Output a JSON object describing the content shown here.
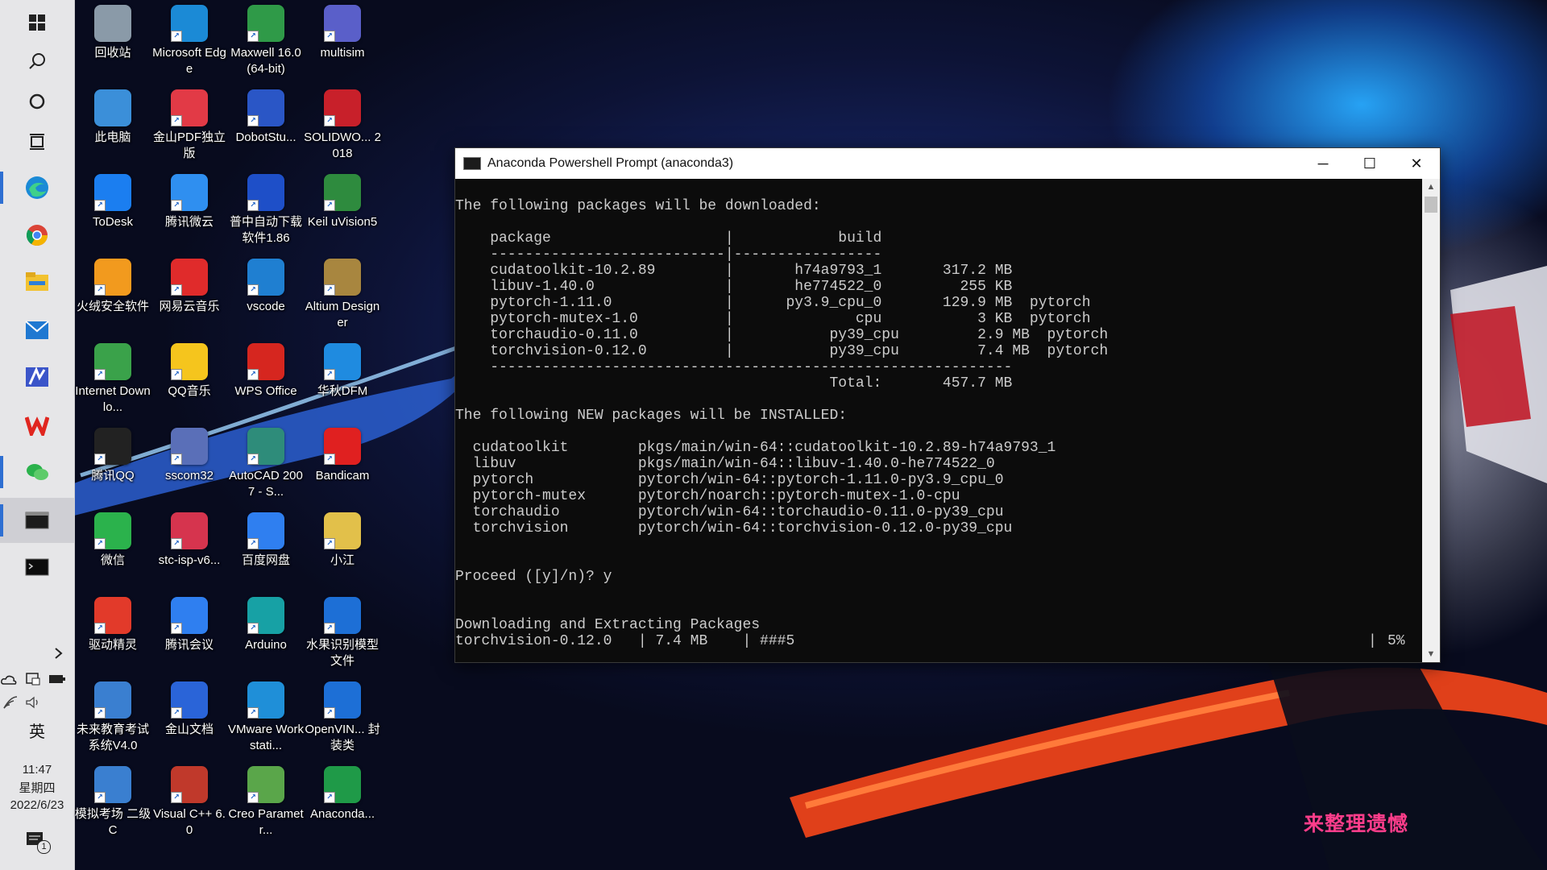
{
  "taskbar": {
    "start_icon": "windows-logo-icon",
    "pinned": [
      {
        "name": "search",
        "icon": "search-icon"
      },
      {
        "name": "cortana",
        "icon": "circle-icon"
      },
      {
        "name": "task-view",
        "icon": "task-view-icon"
      },
      {
        "name": "edge",
        "icon": "edge-icon"
      },
      {
        "name": "chrome",
        "icon": "chrome-icon"
      },
      {
        "name": "file-explorer",
        "icon": "folder-icon"
      },
      {
        "name": "mail",
        "icon": "mail-icon"
      },
      {
        "name": "multisim",
        "icon": "multisim-icon"
      },
      {
        "name": "wps",
        "icon": "wps-icon"
      },
      {
        "name": "wechat",
        "icon": "wechat-icon"
      },
      {
        "name": "anaconda-prompt",
        "icon": "terminal-icon"
      },
      {
        "name": "terminal",
        "icon": "terminal-icon"
      }
    ],
    "ime_label": "英",
    "time": "11:47",
    "weekday": "星期四",
    "date": "2022/6/23",
    "notification_count": "1"
  },
  "desktop": {
    "icons": [
      {
        "label": "回收站",
        "icon": "recycle-bin-icon",
        "color": "#8a9aa8"
      },
      {
        "label": "Microsoft Edge",
        "icon": "edge-icon",
        "color": "#1b8ad6"
      },
      {
        "label": "Maxwell 16.0 (64-bit)",
        "icon": "maxwell-icon",
        "color": "#2f9a48"
      },
      {
        "label": "multisim",
        "icon": "multisim-icon",
        "color": "#5a5fc9"
      },
      {
        "label": "此电脑",
        "icon": "computer-icon",
        "color": "#3b8fd9"
      },
      {
        "label": "金山PDF独立版",
        "icon": "pdf-icon",
        "color": "#e23a46"
      },
      {
        "label": "DobotStu...",
        "icon": "dobot-icon",
        "color": "#2a56c6"
      },
      {
        "label": "SOLIDWO... 2018",
        "icon": "solidworks-icon",
        "color": "#c8202a"
      },
      {
        "label": "ToDesk",
        "icon": "todesk-icon",
        "color": "#1b7ef0"
      },
      {
        "label": "腾讯微云",
        "icon": "weiyun-icon",
        "color": "#2f8ff0"
      },
      {
        "label": "普中自动下载软件1.86",
        "icon": "isp-icon",
        "color": "#1e4fc8"
      },
      {
        "label": "Keil uVision5",
        "icon": "keil-icon",
        "color": "#2e8b3e"
      },
      {
        "label": "火绒安全软件",
        "icon": "huorong-icon",
        "color": "#f29a1e"
      },
      {
        "label": "网易云音乐",
        "icon": "netease-music-icon",
        "color": "#e02b2b"
      },
      {
        "label": "vscode",
        "icon": "vscode-icon",
        "color": "#1f7fd1"
      },
      {
        "label": "Altium Designer",
        "icon": "altium-icon",
        "color": "#a8863f"
      },
      {
        "label": "Internet Downlo...",
        "icon": "idm-icon",
        "color": "#3aa24a"
      },
      {
        "label": "QQ音乐",
        "icon": "qqmusic-icon",
        "color": "#f5c51d"
      },
      {
        "label": "WPS Office",
        "icon": "wps-icon",
        "color": "#d6261f"
      },
      {
        "label": "华秋DFM",
        "icon": "dfm-icon",
        "color": "#1f8be0"
      },
      {
        "label": "腾讯QQ",
        "icon": "qq-icon",
        "color": "#222222"
      },
      {
        "label": "sscom32",
        "icon": "sscom-icon",
        "color": "#5a6fb8"
      },
      {
        "label": "AutoCAD 2007 - S...",
        "icon": "autocad-icon",
        "color": "#2e8c7a"
      },
      {
        "label": "Bandicam",
        "icon": "bandicam-icon",
        "color": "#e02020"
      },
      {
        "label": "微信",
        "icon": "wechat-icon",
        "color": "#2bb24c"
      },
      {
        "label": "stc-isp-v6...",
        "icon": "stc-isp-icon",
        "color": "#d6344e"
      },
      {
        "label": "百度网盘",
        "icon": "baidu-netdisk-icon",
        "color": "#2f7ff0"
      },
      {
        "label": "小江",
        "icon": "folder-doc-icon",
        "color": "#e2c04a"
      },
      {
        "label": "驱动精灵",
        "icon": "driver-icon",
        "color": "#e23a2a"
      },
      {
        "label": "腾讯会议",
        "icon": "tencent-meeting-icon",
        "color": "#2f7ff0"
      },
      {
        "label": "Arduino",
        "icon": "arduino-icon",
        "color": "#17a1a5"
      },
      {
        "label": "水果识别模型文件",
        "icon": "zip-icon",
        "color": "#1d6fd6"
      },
      {
        "label": "未来教育考试系统V4.0",
        "icon": "exam-icon",
        "color": "#3a7fd0"
      },
      {
        "label": "金山文档",
        "icon": "kdocs-icon",
        "color": "#2a64d8"
      },
      {
        "label": "VMware Workstati...",
        "icon": "vmware-icon",
        "color": "#1f8fd8"
      },
      {
        "label": "OpenVIN... 封装类",
        "icon": "zip-icon",
        "color": "#1d6fd6"
      },
      {
        "label": "模拟考场 二级C",
        "icon": "exam-icon",
        "color": "#3a7fd0"
      },
      {
        "label": "Visual C++ 6.0",
        "icon": "visual-cpp-icon",
        "color": "#c0392b"
      },
      {
        "label": "Creo Parametr...",
        "icon": "creo-icon",
        "color": "#5aa64a"
      },
      {
        "label": "Anaconda...",
        "icon": "anaconda-icon",
        "color": "#1f9a48"
      }
    ]
  },
  "window": {
    "title": "Anaconda Powershell Prompt (anaconda3)",
    "controls": {
      "minimize": "─",
      "maximize": "☐",
      "close": "✕"
    },
    "console_lines": [
      "The following packages will be downloaded:",
      "",
      "    package                    |            build",
      "    ---------------------------|-----------------",
      "    cudatoolkit-10.2.89        |       h74a9793_1       317.2 MB",
      "    libuv-1.40.0               |       he774522_0         255 KB",
      "    pytorch-1.11.0             |      py3.9_cpu_0       129.9 MB  pytorch",
      "    pytorch-mutex-1.0          |              cpu           3 KB  pytorch",
      "    torchaudio-0.11.0          |           py39_cpu         2.9 MB  pytorch",
      "    torchvision-0.12.0         |           py39_cpu         7.4 MB  pytorch",
      "    ------------------------------------------------------------",
      "                                           Total:       457.7 MB",
      "",
      "The following NEW packages will be INSTALLED:",
      "",
      "  cudatoolkit        pkgs/main/win-64::cudatoolkit-10.2.89-h74a9793_1",
      "  libuv              pkgs/main/win-64::libuv-1.40.0-he774522_0",
      "  pytorch            pytorch/win-64::pytorch-1.11.0-py3.9_cpu_0",
      "  pytorch-mutex      pytorch/noarch::pytorch-mutex-1.0-cpu",
      "  torchaudio         pytorch/win-64::torchaudio-0.11.0-py39_cpu",
      "  torchvision        pytorch/win-64::torchvision-0.12.0-py39_cpu",
      "",
      "",
      "Proceed ([y]/n)? y",
      "",
      "",
      "Downloading and Extracting Packages",
      "torchvision-0.12.0   | 7.4 MB    | ###5"
    ],
    "progress_percent_label": "5%"
  },
  "watermark": "来整理遗憾"
}
